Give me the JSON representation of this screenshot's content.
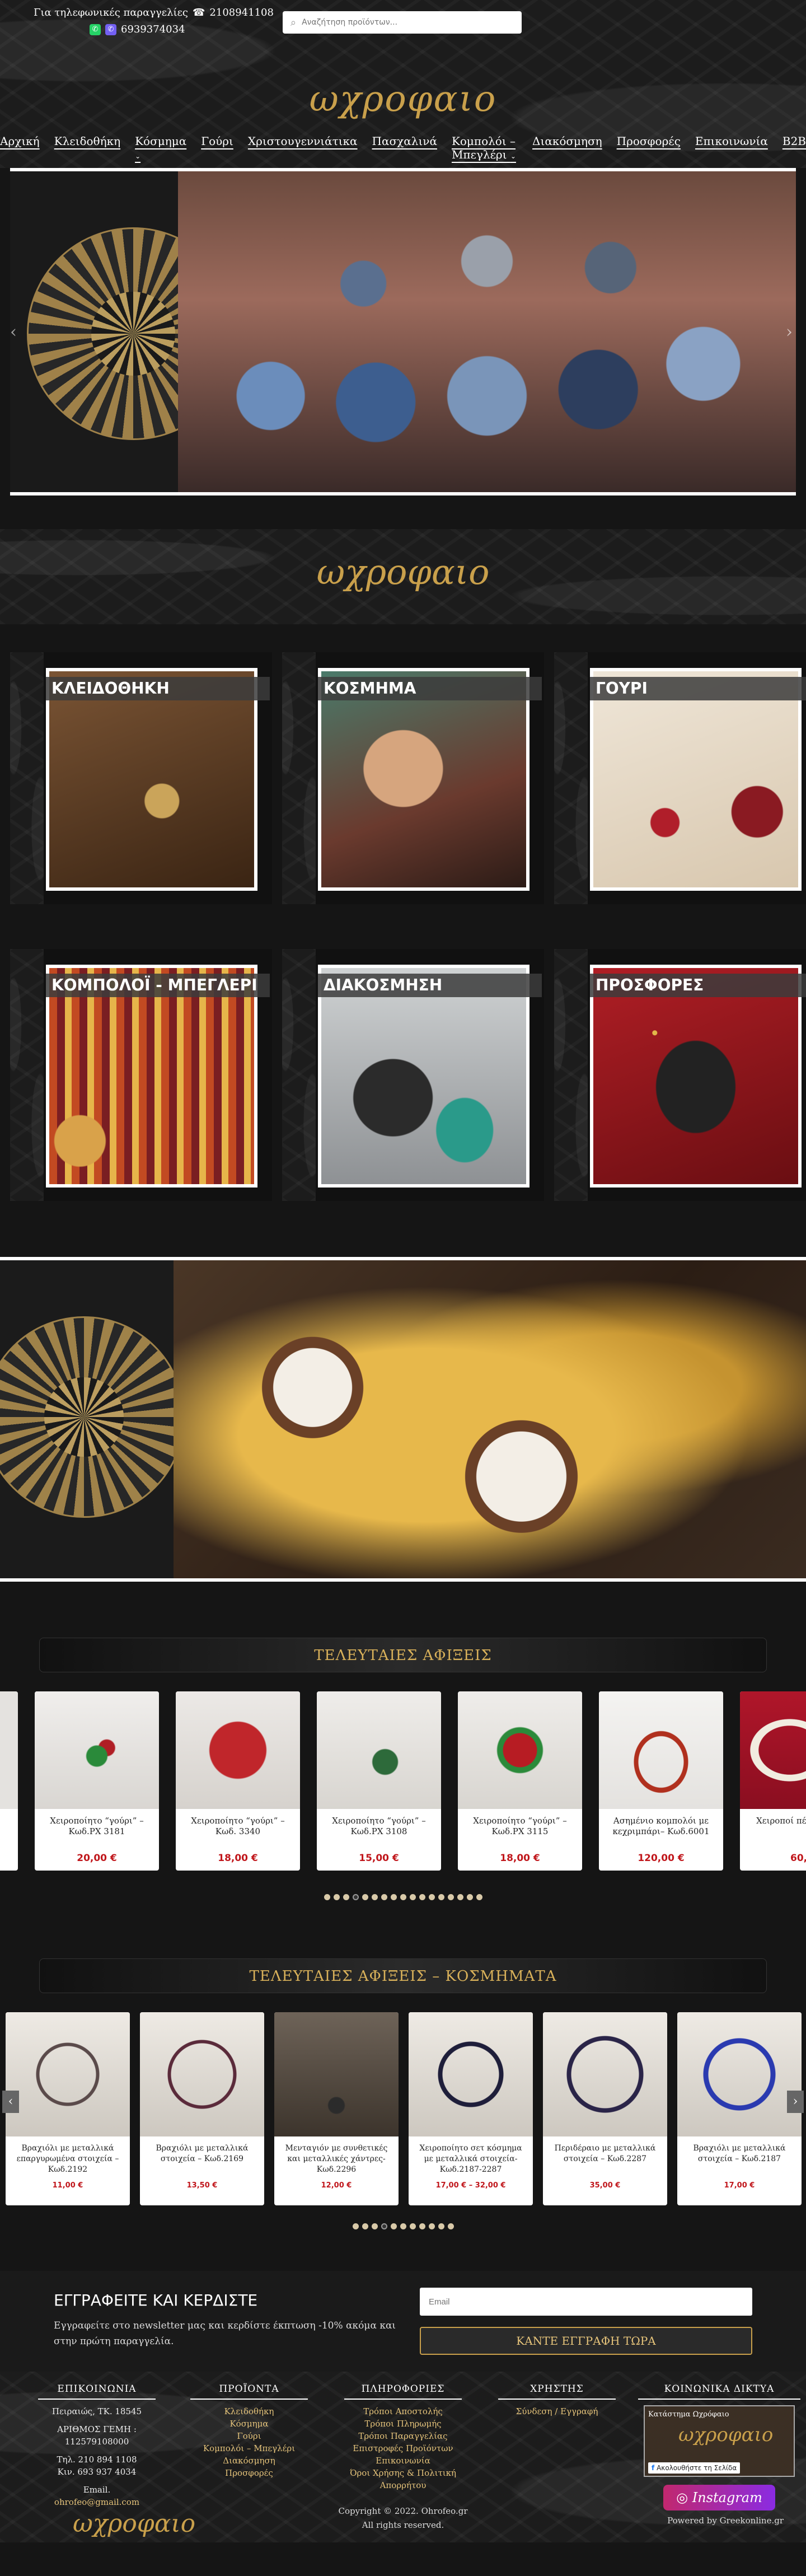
{
  "header": {
    "phone_prefix": "Για τηλεφωνικές παραγγελίες",
    "phone": "2108941108",
    "mobile": "6939374034",
    "search_placeholder": "Αναζήτηση προϊόντων...",
    "logo": "ωχροφαιο",
    "nav": [
      "Αρχική",
      "Κλειδοθήκη",
      "Κόσμημα",
      "Γούρι",
      "Χριστουγεννιάτικα",
      "Πασχαλινά",
      "Κομπολόι – Μπεγλέρι",
      "Διακόσμηση",
      "Προσφορές",
      "Επικοινωνία",
      "B2B"
    ]
  },
  "band_logo": "ωχροφαιο",
  "categories": [
    {
      "label": "ΚΛΕΙΔΟΘΗΚΗ",
      "color": "#5a3b22"
    },
    {
      "label": "ΚΟΣΜΗΜΑ",
      "color": "#6a3a2e"
    },
    {
      "label": "ΓΟΥΡΙ",
      "color": "#d9c9b4"
    },
    {
      "label": "ΚΟΜΠΟΛΟΪ - ΜΠΕΓΛΕΡΙ",
      "color": "#b33a2a"
    },
    {
      "label": "ΔΙΑΚΟΣΜΗΣΗ",
      "color": "#3a3a3a"
    },
    {
      "label": "ΠΡΟΣΦΟΡΕΣ",
      "color": "#8a1418"
    }
  ],
  "latest": {
    "title": "ΤΕΛΕΥΤΑΙΕΣ ΑΦΙΞΕΙΣ",
    "items": [
      {
        "title": "Χειροποίητο “γούρι” – Κωδ.ΡΧ 3181",
        "price": "20,00 €"
      },
      {
        "title": "Χειροποίητο “γούρι” – Κωδ. 3340",
        "price": "18,00 €"
      },
      {
        "title": "Χειροποίητο “γούρι” – Κωδ.ΡΧ 3108",
        "price": "15,00 €"
      },
      {
        "title": "Χειροποίητο “γούρι” – Κωδ.ΡΧ 3115",
        "price": "18,00 €"
      },
      {
        "title": "Ασημένιο κομπολόι με κεχριμπάρι– Κωδ.6001",
        "price": "120,00 €"
      }
    ],
    "edge_right_title": "Χειροποί πέτρες ορυκ",
    "edge_right_price": "60,0"
  },
  "jewelry": {
    "title": "ΤΕΛΕΥΤΑΙΕΣ ΑΦΙΞΕΙΣ – ΚΟΣΜΗΜΑΤΑ",
    "items": [
      {
        "title": "Βραχιόλι με μεταλλικά επαργυρωμένα στοιχεία – Κωδ.2192",
        "price": "11,00 €"
      },
      {
        "title": "Βραχιόλι με μεταλλικά στοιχεία – Κωδ.2169",
        "price": "13,50 €"
      },
      {
        "title": "Μενταγιόν με συνθετικές και μεταλλικές χάντρες- Κωδ.2296",
        "price": "12,00 €"
      },
      {
        "title": "Χειροποίητο σετ κόσμημα με μεταλλικά στοιχεία- Κωδ.2187-2287",
        "price": "17,00 € – 32,00 €"
      },
      {
        "title": "Περιδέραιο με μεταλλικά στοιχεία – Κωδ.2287",
        "price": "35,00 €"
      },
      {
        "title": "Βραχιόλι με μεταλλικά στοιχεία – Κωδ.2187",
        "price": "17,00 €"
      }
    ]
  },
  "newsletter": {
    "title": "ΕΓΓΡΑΦΕΙΤΕ ΚΑΙ ΚΕΡΔΙΣΤΕ",
    "text": "Εγγραφείτε στο newsletter μας και κερδίστε έκπτωση -10% ακόμα και στην πρώτη παραγγελία.",
    "placeholder": "Email",
    "button": "ΚΑΝΤΕ ΕΓΓΡΑΦΗ ΤΩΡΑ"
  },
  "footer": {
    "contact": {
      "title": "ΕΠΙΚΟΙΝΩΝΙΑ",
      "address": "Πειραιώς, ΤΚ. 18545",
      "gemi": "ΑΡΙΘΜΟΣ ΓΕΜΗ : 112579108000",
      "tel": "Τηλ. 210 894 1108",
      "mob": "Κιν. 693 937 4034",
      "email_label": "Email.",
      "email": "ohrofeo@gmail.com"
    },
    "products": {
      "title": "ΠΡΟΪΟΝΤΑ",
      "links": [
        "Κλειδοθήκη",
        "Κόσμημα",
        "Γούρι",
        "Κομπολόι – Μπεγλέρι",
        "Διακόσμηση",
        "Προσφορές"
      ]
    },
    "info": {
      "title": "ΠΛΗΡΟΦΟΡΙΕΣ",
      "links": [
        "Τρόποι Αποστολής",
        "Τρόποι Πληρωμής",
        "Τρόποι Παραγγελίας",
        "Επιστροφές Προϊόντων",
        "Επικοινωνία",
        "Όροι Χρήσης & Πολιτική Απορρήτου"
      ]
    },
    "user": {
      "title": "ΧΡΗΣΤΗΣ",
      "links": [
        "Σύνδεση / Εγγραφή"
      ]
    },
    "social": {
      "title": "ΚΟΙΝΩΝΙΚΑ ΔΙΚΤΥΑ",
      "fb_name": "Κατάστημα Ωχρόφαιο",
      "fb_like": "Ακολουθήστε τη Σελίδα",
      "insta": "Instagram"
    },
    "copyright": "Copyright © 2022. Ohrofeo.gr",
    "rights": "All rights reserved.",
    "logo": "ωχροφαιο",
    "powered": "Powered by Greekonline.gr"
  }
}
